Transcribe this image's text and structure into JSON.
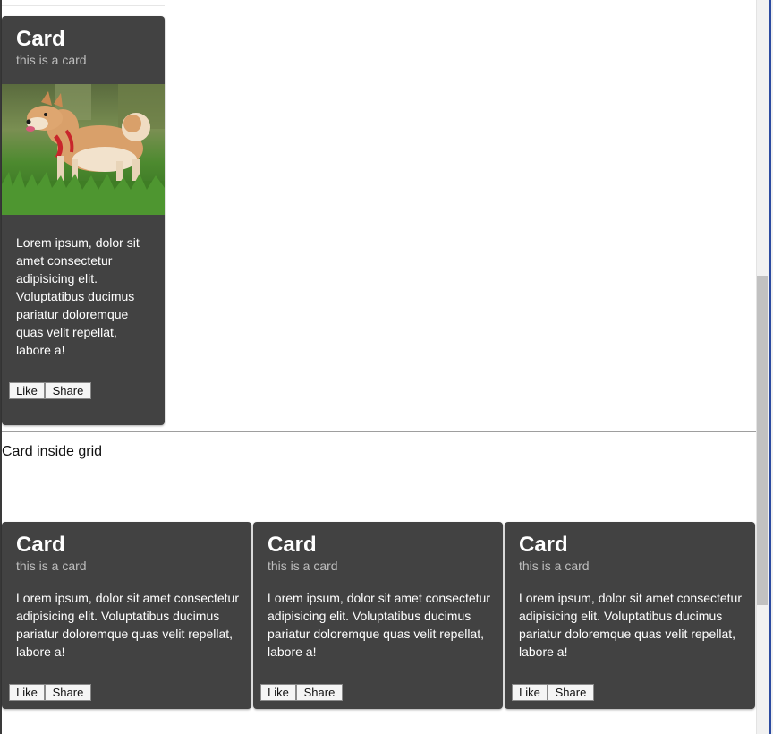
{
  "single_card": {
    "title": "Card",
    "subtitle": "this is a card",
    "body": "Lorem ipsum, dolor sit amet consectetur adipisicing elit. Voluptatibus ducimus pariatur doloremque quas velit repellat, labore a!",
    "like_label": "Like",
    "share_label": "Share"
  },
  "section_label": "Card inside grid",
  "grid_cards": [
    {
      "title": "Card",
      "subtitle": "this is a card",
      "body": "Lorem ipsum, dolor sit amet consectetur adipisicing elit. Voluptatibus ducimus pariatur doloremque quas velit repellat, labore a!",
      "like_label": "Like",
      "share_label": "Share"
    },
    {
      "title": "Card",
      "subtitle": "this is a card",
      "body": "Lorem ipsum, dolor sit amet consectetur adipisicing elit. Voluptatibus ducimus pariatur doloremque quas velit repellat, labore a!",
      "like_label": "Like",
      "share_label": "Share"
    },
    {
      "title": "Card",
      "subtitle": "this is a card",
      "body": "Lorem ipsum, dolor sit amet consectetur adipisicing elit. Voluptatibus ducimus pariatur doloremque quas velit repellat, labore a!",
      "like_label": "Like",
      "share_label": "Share"
    }
  ],
  "colors": {
    "card_bg": "#424242",
    "subtitle": "#bdbdbd",
    "page_bg": "#ffffff"
  }
}
